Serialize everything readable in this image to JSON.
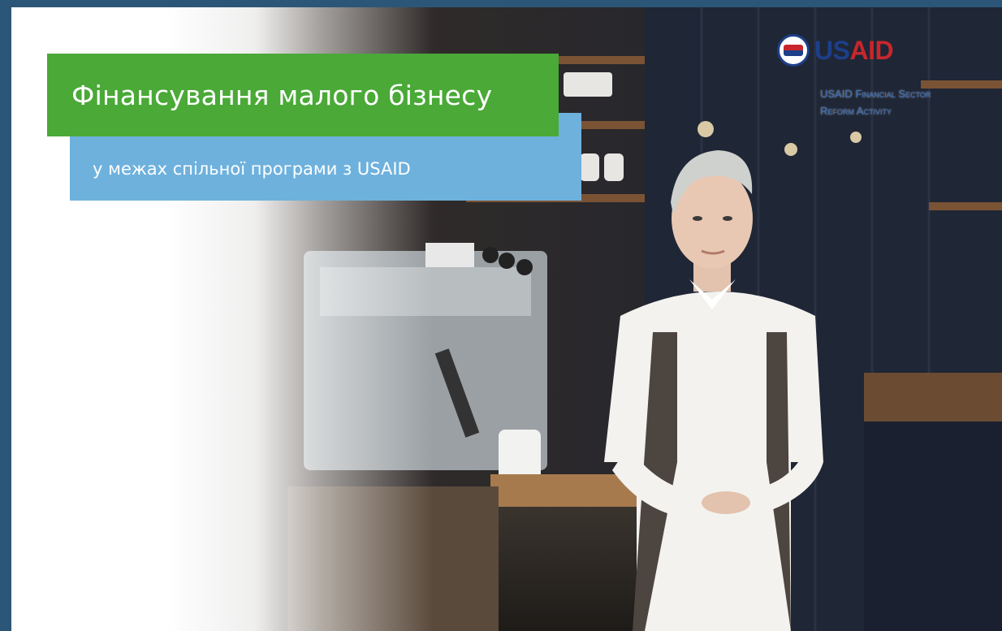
{
  "banner": {
    "title": "Фінансування малого бізнесу",
    "subtitle": "у межах спільної програми з USAID"
  },
  "logo": {
    "brand_us": "US",
    "brand_aid": "AID",
    "activity_line1": "USAID Financial Sector",
    "activity_line2": "Reform Activity"
  },
  "colors": {
    "page_background": "#2b5677",
    "title_green": "#4aa937",
    "subtitle_blue": "#6eb1dd",
    "usaid_blue": "#1d3f8a",
    "usaid_red": "#c8262c"
  }
}
